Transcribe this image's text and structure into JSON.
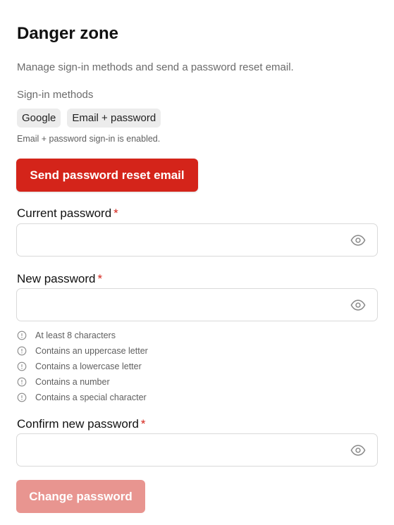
{
  "header": {
    "title": "Danger zone",
    "description": "Manage sign-in methods and send a password reset email."
  },
  "signin": {
    "label": "Sign-in methods",
    "methods": [
      "Google",
      "Email + password"
    ],
    "status": "Email + password sign-in is enabled."
  },
  "reset_button": "Send password reset email",
  "fields": {
    "current": {
      "label": "Current password",
      "required_mark": "*",
      "value": ""
    },
    "new": {
      "label": "New password",
      "required_mark": "*",
      "value": ""
    },
    "confirm": {
      "label": "Confirm new password",
      "required_mark": "*",
      "value": ""
    }
  },
  "requirements": [
    "At least 8 characters",
    "Contains an uppercase letter",
    "Contains a lowercase letter",
    "Contains a number",
    "Contains a special character"
  ],
  "change_button": "Change password",
  "icons": {
    "eye": "eye-icon",
    "requirement": "info-circle-icon"
  },
  "colors": {
    "danger": "#d4241a",
    "disabled_danger": "#e89590",
    "muted_text": "#6b6b6b"
  }
}
